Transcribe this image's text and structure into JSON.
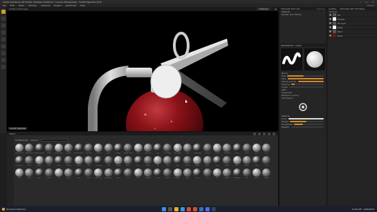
{
  "window": {
    "title": "Adobe Substance 3D Painter (Substance Edition) - Lorenzo Extinguisher - FireExtinguisher_final",
    "controls": [
      "—",
      "□",
      "✕"
    ]
  },
  "menu": [
    "File",
    "Edit",
    "Mode",
    "Window",
    "Viewport",
    "Plugins",
    "JavaScript",
    "Help"
  ],
  "menu_right": "Export",
  "viewport": {
    "tab": "Untitled_0001.spp",
    "mode_label": "Material",
    "status": "1/128 | Sample"
  },
  "texture_set_list": {
    "title": "TEXTURE SET LIST",
    "settings": "Settings",
    "items": [
      "Material",
      "Rubber and Handle"
    ]
  },
  "properties": {
    "title": "PROPERTIES - PAINT",
    "brush_label": "Brush",
    "rows": [
      "Size",
      "Flow",
      "Stroke opacity",
      "Spacing",
      "Angle",
      "Jitter",
      "Alignment",
      "Backface culling",
      "Size Space"
    ],
    "material_label": "Material",
    "color_label": "Color",
    "height_label": "Height",
    "roughness_label": "Roughness",
    "metallic_label": "Metallic"
  },
  "layers": {
    "title": "LAYERS",
    "tabs": [
      "LAYERS",
      "TEXTURE SET SETTINGS"
    ],
    "blend": "Normal",
    "items": [
      "Fill",
      "Rubber",
      "Fill layer",
      "Mask",
      "Paint",
      "Base"
    ]
  },
  "shelf": {
    "title": "SHELF",
    "search_label": "Search",
    "filter_label": "All Materials",
    "items": [
      "Alien Metal",
      "Aluminium",
      "Aluminium Rough",
      "Brass",
      "Brass Worn",
      "Bronze",
      "Bronze Armor",
      "Car Paint",
      "Chrome",
      "Cobalt",
      "Copper",
      "Copper Worn",
      "Gold",
      "Gold Pure",
      "Iron",
      "Iron Forge",
      "Iron Rough",
      "Lead",
      "Metal Edge",
      "Nickel",
      "Plastic",
      "Platinum",
      "Rust",
      "Silver",
      "Steel",
      "Zinc",
      "Artificial",
      "Bark",
      "Basalt",
      "Bone",
      "Brick",
      "Carbon",
      "Cement",
      "Clay",
      "Concrete",
      "Cork",
      "Crystal",
      "Fabric",
      "Felt",
      "Gravel",
      "Ice",
      "Ivory",
      "Jade",
      "Leather",
      "Marble",
      "Moss",
      "Mud",
      "Paper",
      "Rock",
      "Rubber",
      "Sand",
      "Skin",
      "Slate",
      "Snow",
      "Soil",
      "Stone",
      "Tile",
      "Velvet",
      "Wax",
      "Wood",
      "Wood Old",
      "Wood Dark",
      "Wool",
      "Shell",
      "Pearl",
      "Obsidian",
      "Onyx",
      "Quartz",
      "Granite",
      "Glass",
      "Foam",
      "Dirt",
      "Coal",
      "Ceramic",
      "Cardboard",
      "Ash",
      "Acrylic",
      "Amber"
    ]
  },
  "taskbar": {
    "weather": "Windows Defender",
    "time": "11:50 AM",
    "date": "9/26/2023"
  },
  "colors": {
    "accent": "#d18c2b",
    "panel": "#252525",
    "viewport_bg": "#000000",
    "extinguisher_red": "#8b1218"
  }
}
